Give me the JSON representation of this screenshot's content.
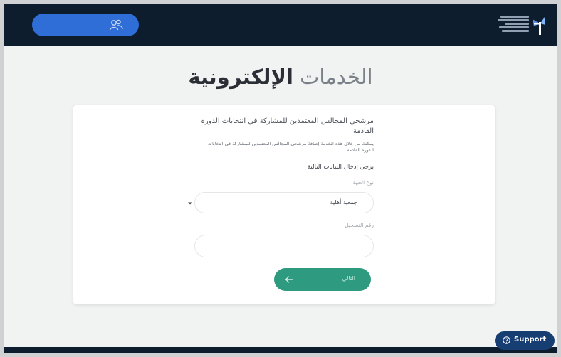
{
  "page": {
    "title_light": "الخدمات",
    "title_bold": "الإلكترونية"
  },
  "service": {
    "title": "مرشحي المجالس المعتمدين للمشاركة في انتخابات الدورة القادمة",
    "description": "يمكنك من خلال هذه الخدمة إضافة مرشحي المجالس المعتمدين للمشاركة في انتخابات الدورة القادمة",
    "instruction": "يرجى إدخال البيانات التالية"
  },
  "form": {
    "entity_type_label": "نوع الجهة",
    "entity_type_value": "جمعية أهلية",
    "registration_label": "رقم التسجيل",
    "registration_value": "",
    "next_label": "التالي"
  },
  "support": {
    "label": "Support"
  },
  "colors": {
    "header": "#0d1d2e",
    "accent_blue": "#2f6ed6",
    "button_green": "#2e9a7f",
    "support_bg": "#173e73"
  },
  "icons": {
    "account": "people-icon",
    "next": "arrow-left-icon",
    "dropdown": "chevron-down-icon",
    "support": "question-circle-icon",
    "logo": "center-logo"
  }
}
